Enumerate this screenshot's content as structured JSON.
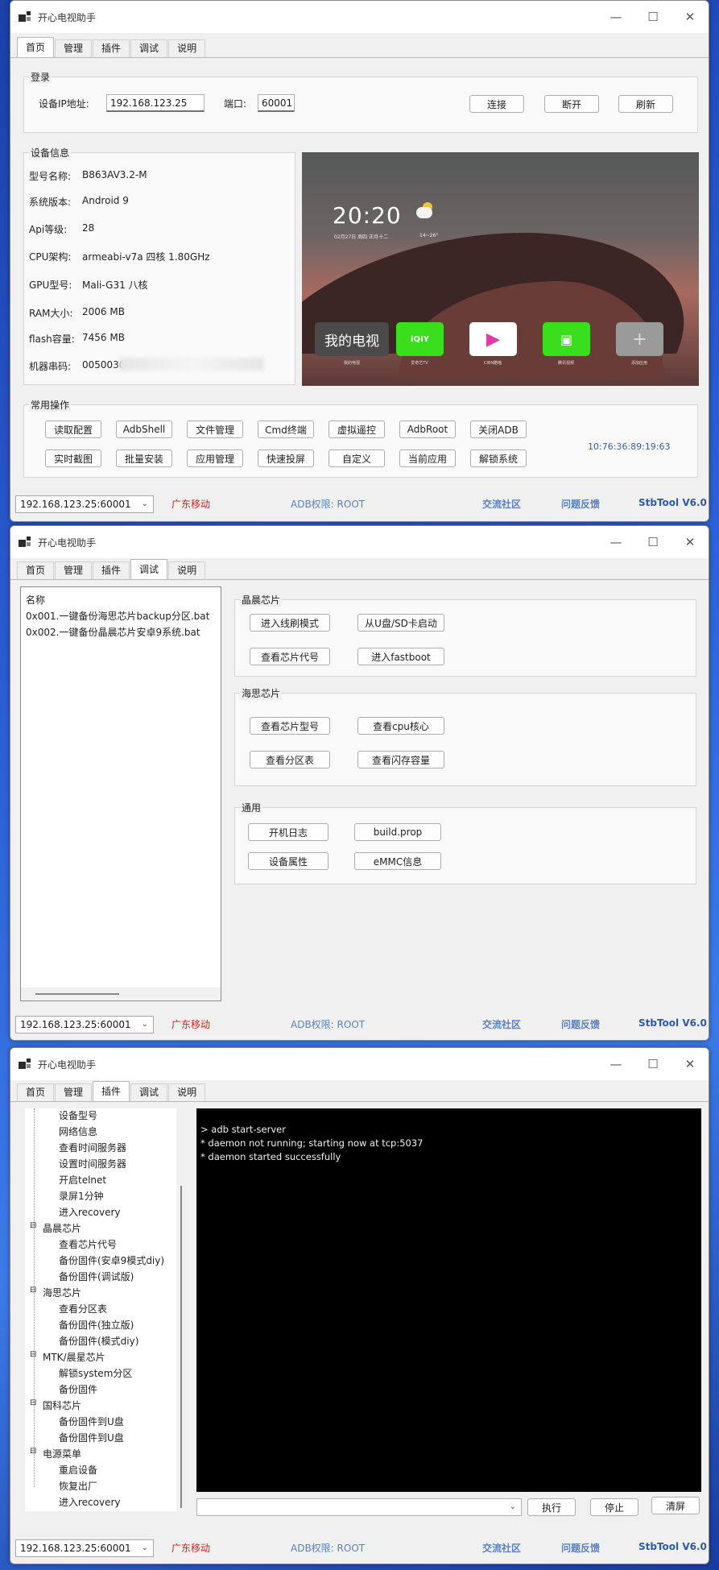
{
  "app_title": "开心电视助手",
  "window_controls": {
    "minimize": "—",
    "maximize": "☐",
    "close": "✕"
  },
  "tabs": [
    "首页",
    "管理",
    "插件",
    "调试",
    "说明"
  ],
  "home": {
    "login_title": "登录",
    "ip_label": "设备IP地址:",
    "ip_value": "192.168.123.25",
    "port_label": "端口:",
    "port_value": "60001",
    "connect_btn": "连接",
    "disconnect_btn": "断开",
    "refresh_btn": "刷新",
    "device_info_title": "设备信息",
    "info_rows": [
      {
        "label": "型号名称:",
        "value": "B863AV3.2-M"
      },
      {
        "label": "系统版本:",
        "value": "Android 9"
      },
      {
        "label": "Api等级:",
        "value": "28"
      },
      {
        "label": "CPU架构:",
        "value": "armeabi-v7a 四核 1.80GHz"
      },
      {
        "label": "GPU型号:",
        "value": "Mali-G31 八核"
      },
      {
        "label": "RAM大小:",
        "value": "2006 MB"
      },
      {
        "label": "flash容量:",
        "value": "7456 MB"
      },
      {
        "label": "机器串码:",
        "value": "0050030"
      }
    ],
    "preview": {
      "time": "20:20",
      "date": "02月27日  周四 正月十二",
      "temp": "14~26°",
      "tile_main": "我的电视",
      "tile_labels": [
        "我的电视",
        "爱奇艺TV",
        "CIBN酷喵",
        "腾讯视频",
        "添加应用"
      ]
    },
    "common_ops_title": "常用操作",
    "ops_row1": [
      "读取配置",
      "AdbShell",
      "文件管理",
      "Cmd终端",
      "虚拟遥控",
      "AdbRoot",
      "关闭ADB"
    ],
    "ops_row2": [
      "实时截图",
      "批量安装",
      "应用管理",
      "快速投屏",
      "自定义",
      "当前应用",
      "解锁系统"
    ],
    "mac": "10:76:36:89:19:63"
  },
  "status_bar": {
    "device": "192.168.123.25:60001",
    "carrier": "广东移动",
    "adb_permission": "ADB权限: ROOT",
    "community": "交流社区",
    "feedback": "问题反馈",
    "version": "StbTool V6.0"
  },
  "debug": {
    "list_header": "名称",
    "list_items": [
      "0x001.一键备份海思芯片backup分区.bat",
      "0x002.一键备份晶晨芯片安卓9系统.bat"
    ],
    "amlogic_title": "晶晨芯片",
    "amlogic_buttons": [
      "进入线刷模式",
      "从U盘/SD卡启动",
      "查看芯片代号",
      "进入fastboot"
    ],
    "hisilicon_title": "海思芯片",
    "hisilicon_buttons": [
      "查看芯片型号",
      "查看cpu核心",
      "查看分区表",
      "查看闪存容量"
    ],
    "general_title": "通用",
    "general_buttons": [
      "开机日志",
      "build.prop",
      "设备属性",
      "eMMC信息"
    ]
  },
  "plugins": {
    "tree": [
      {
        "text": "设备型号",
        "level": 2
      },
      {
        "text": "网络信息",
        "level": 2
      },
      {
        "text": "查看时间服务器",
        "level": 2
      },
      {
        "text": "设置时间服务器",
        "level": 2
      },
      {
        "text": "开启telnet",
        "level": 2
      },
      {
        "text": "录屏1分钟",
        "level": 2
      },
      {
        "text": "进入recovery",
        "level": 2
      },
      {
        "text": "晶晨芯片",
        "level": 1
      },
      {
        "text": "查看芯片代号",
        "level": 2
      },
      {
        "text": "备份固件(安卓9模式diy)",
        "level": 2
      },
      {
        "text": "备份固件(调试版)",
        "level": 2
      },
      {
        "text": "海思芯片",
        "level": 1
      },
      {
        "text": "查看分区表",
        "level": 2
      },
      {
        "text": "备份固件(独立版)",
        "level": 2
      },
      {
        "text": "备份固件(模式diy)",
        "level": 2
      },
      {
        "text": "MTK/晨星芯片",
        "level": 1
      },
      {
        "text": "解锁system分区",
        "level": 2
      },
      {
        "text": "备份固件",
        "level": 2
      },
      {
        "text": "国科芯片",
        "level": 1
      },
      {
        "text": "备份固件到U盘",
        "level": 2
      },
      {
        "text": "备份固件到U盘",
        "level": 2
      },
      {
        "text": "电源菜单",
        "level": 1
      },
      {
        "text": "重启设备",
        "level": 2
      },
      {
        "text": "恢复出厂",
        "level": 2
      },
      {
        "text": "进入recovery",
        "level": 2
      }
    ],
    "console_lines": [
      "> adb start-server",
      "* daemon not running; starting now at tcp:5037",
      "* daemon started successfully"
    ],
    "exec_btn": "执行",
    "stop_btn": "停止",
    "clear_btn": "清屏"
  }
}
